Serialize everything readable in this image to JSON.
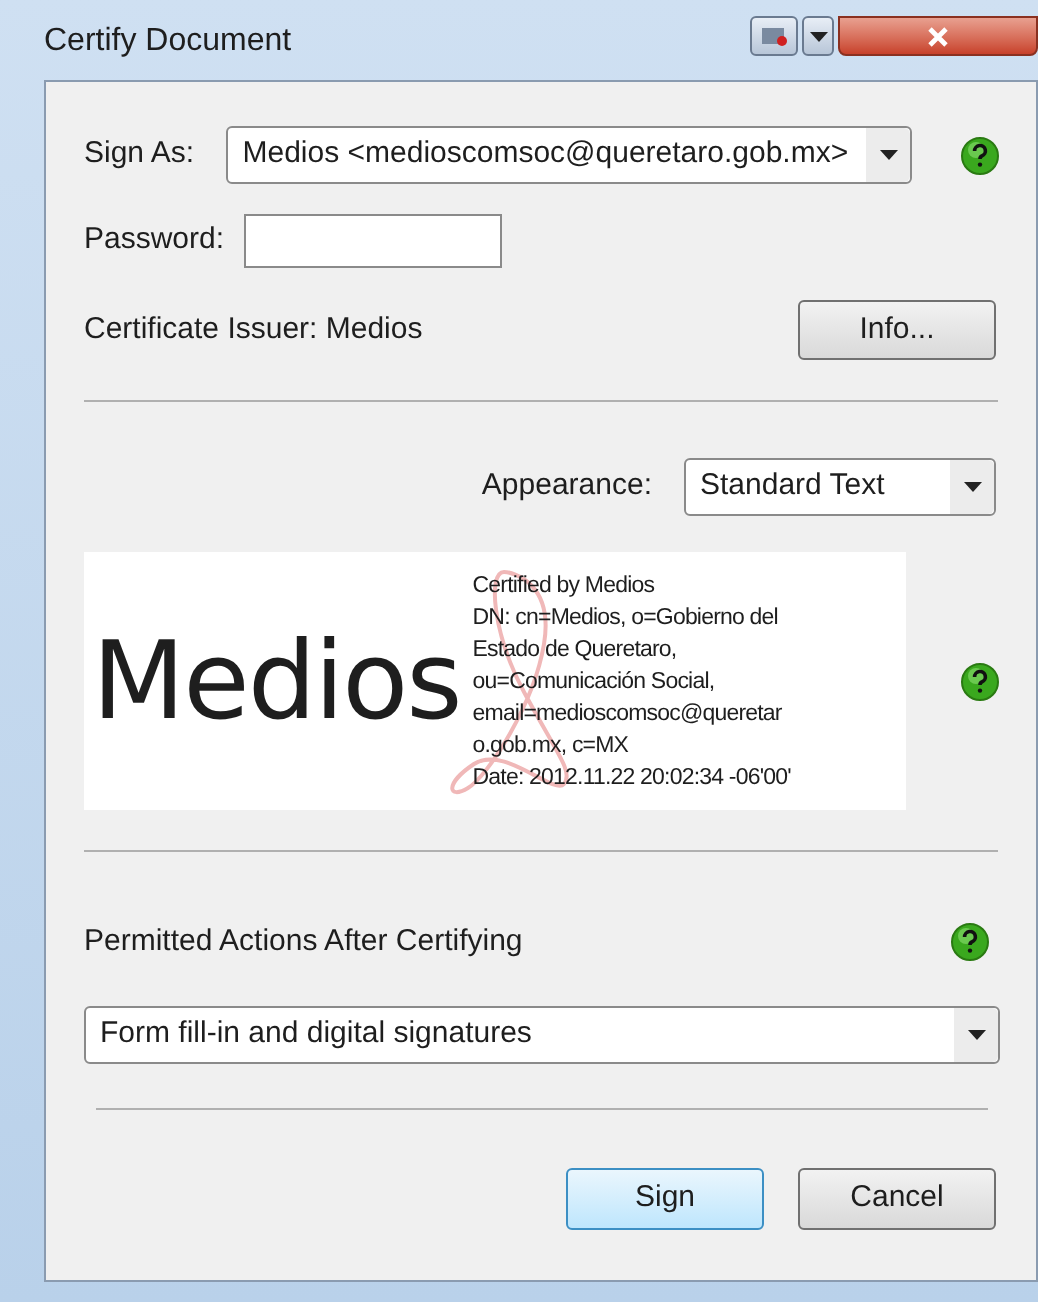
{
  "window": {
    "title": "Certify Document"
  },
  "sign_as": {
    "label": "Sign As:",
    "value": "Medios <medioscomsoc@queretaro.gob.mx>"
  },
  "password": {
    "label": "Password:"
  },
  "issuer": {
    "label": "Certificate Issuer: Medios"
  },
  "info_button": "Info...",
  "appearance": {
    "label": "Appearance:",
    "value": "Standard Text"
  },
  "signature_preview": {
    "name": "Medios",
    "lines": [
      "Certified by Medios",
      "DN: cn=Medios, o=Gobierno del",
      "Estado de Queretaro,",
      "ou=Comunicación Social,",
      "email=medioscomsoc@queretar",
      "o.gob.mx, c=MX",
      "Date: 2012.11.22 20:02:34 -06'00'"
    ]
  },
  "permitted": {
    "label": "Permitted Actions After Certifying",
    "value": "Form fill-in and digital signatures"
  },
  "buttons": [
    {
      "label": "Sign",
      "default": true
    },
    {
      "label": "Cancel",
      "default": false
    }
  ]
}
